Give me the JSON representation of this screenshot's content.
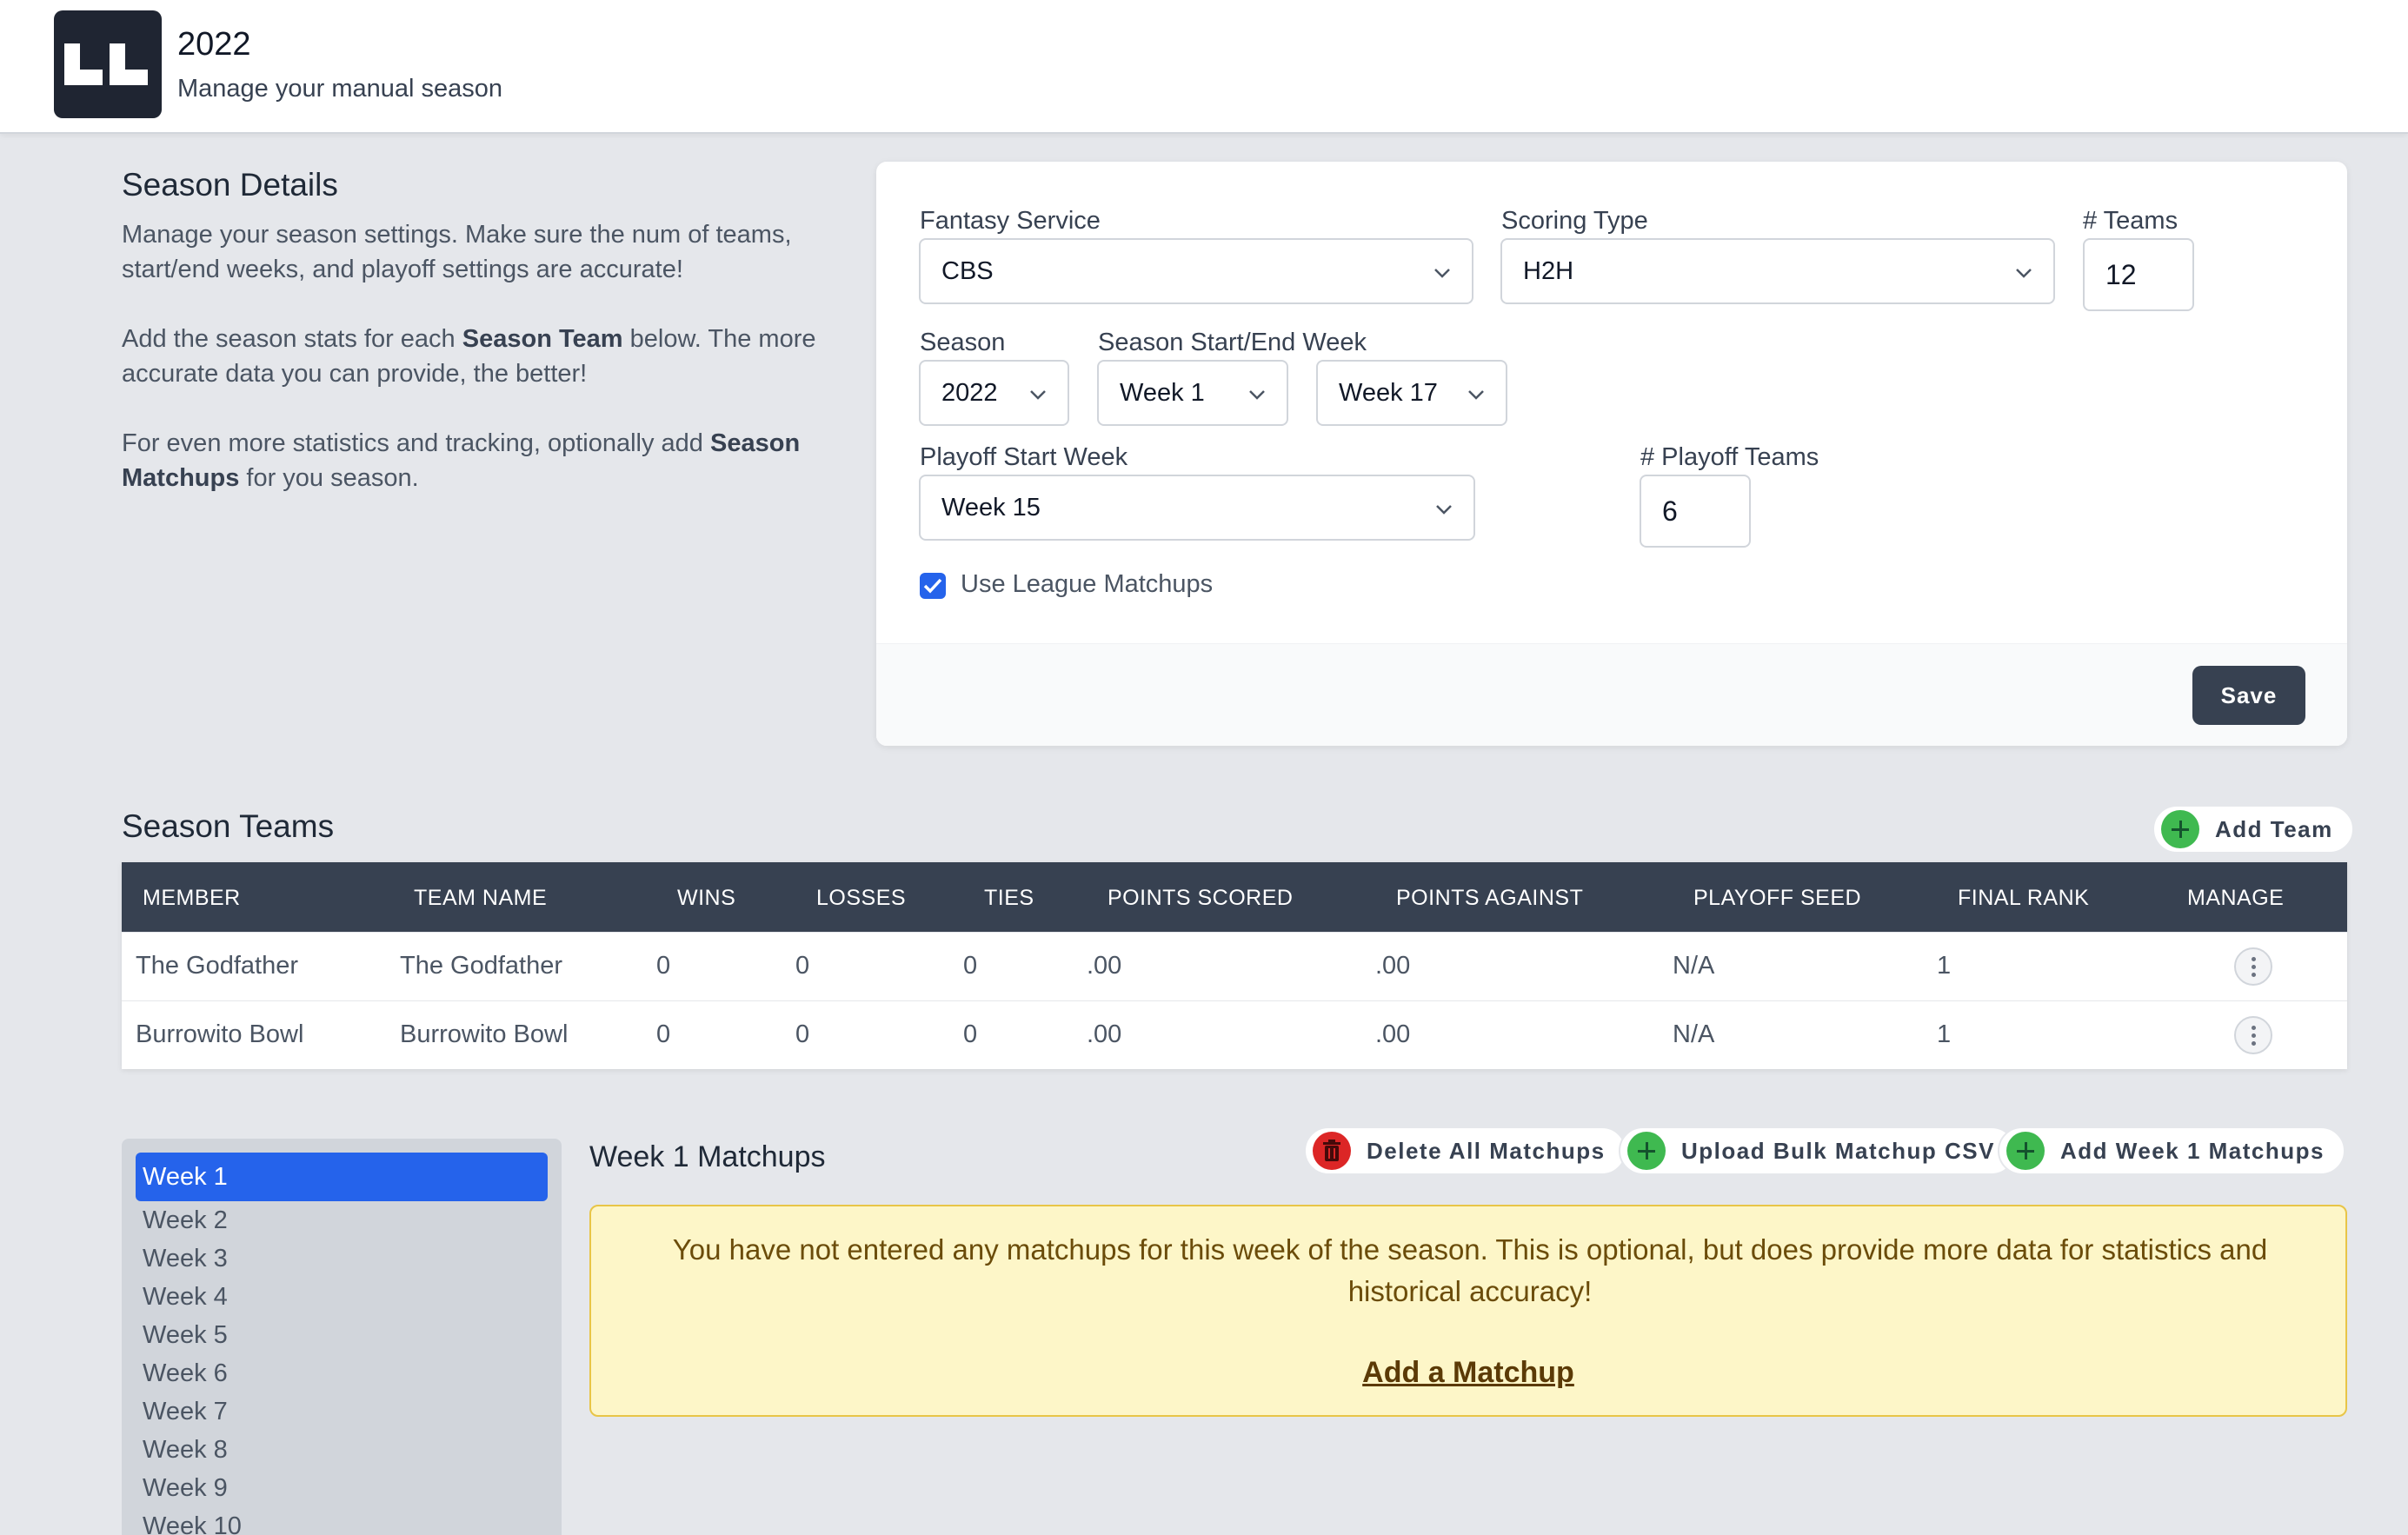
{
  "header": {
    "title": "2022",
    "subtitle": "Manage your manual season",
    "logo_text": "LL"
  },
  "season_details": {
    "title": "Season Details",
    "p1": "Manage your season settings. Make sure the num of teams, start/end weeks, and playoff settings are accurate!",
    "p2_pre": "Add the season stats for each ",
    "p2_bold": "Season Team",
    "p2_post": " below. The more accurate data you can provide, the better!",
    "p3_pre": "For even more statistics and tracking, optionally add ",
    "p3_bold": "Season Matchups",
    "p3_post": " for you season."
  },
  "settings": {
    "fantasy_service_label": "Fantasy Service",
    "fantasy_service_value": "CBS",
    "scoring_type_label": "Scoring Type",
    "scoring_type_value": "H2H",
    "num_teams_label": "# Teams",
    "num_teams_value": "12",
    "season_label": "Season",
    "season_value": "2022",
    "start_end_label": "Season Start/End Week",
    "start_week_value": "Week 1",
    "end_week_value": "Week 17",
    "playoff_start_label": "Playoff Start Week",
    "playoff_start_value": "Week 15",
    "playoff_teams_label": "# Playoff Teams",
    "playoff_teams_value": "6",
    "use_league_matchups_label": "Use League Matchups",
    "use_league_matchups_checked": true,
    "save_label": "Save"
  },
  "season_teams": {
    "title": "Season Teams",
    "add_team_label": "Add Team",
    "columns": [
      "MEMBER",
      "TEAM NAME",
      "WINS",
      "LOSSES",
      "TIES",
      "POINTS SCORED",
      "POINTS AGAINST",
      "PLAYOFF SEED",
      "FINAL RANK",
      "MANAGE"
    ],
    "rows": [
      [
        "The Godfather",
        "The Godfather",
        "0",
        "0",
        "0",
        ".00",
        ".00",
        "N/A",
        "1"
      ],
      [
        "Burrowito Bowl",
        "Burrowito Bowl",
        "0",
        "0",
        "0",
        ".00",
        ".00",
        "N/A",
        "1"
      ]
    ]
  },
  "weeks": {
    "active": "Week 1",
    "items": [
      "Week 2",
      "Week 3",
      "Week 4",
      "Week 5",
      "Week 6",
      "Week 7",
      "Week 8",
      "Week 9",
      "Week 10"
    ]
  },
  "matchups": {
    "title": "Week 1 Matchups",
    "delete_all_label": "Delete All Matchups",
    "upload_csv_label": "Upload Bulk Matchup CSV",
    "add_week_label": "Add Week 1 Matchups",
    "alert_text": "You have not entered any matchups for this week of the season. This is optional, but does provide more data for statistics and historical accuracy!",
    "alert_link": "Add a Matchup"
  },
  "colors": {
    "header_bg": "#ffffff",
    "page_bg": "#e5e7eb",
    "table_header": "#374151",
    "active_week": "#2563eb",
    "alert_bg": "#fdf6c8",
    "success_green": "#3fb950",
    "danger_red": "#dc2626"
  },
  "icons": [
    "chevron-down-icon",
    "check-icon",
    "plus-icon",
    "trash-icon",
    "more-vertical-icon"
  ]
}
